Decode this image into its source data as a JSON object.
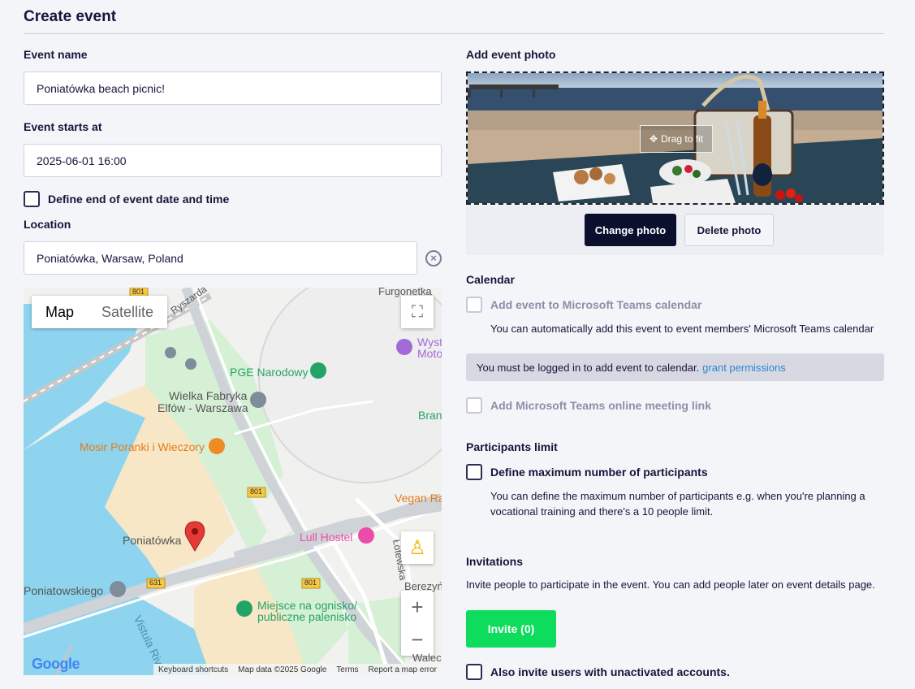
{
  "page": {
    "title": "Create event"
  },
  "left": {
    "event_name_label": "Event name",
    "event_name_value": "Poniatówka beach picnic!",
    "starts_label": "Event starts at",
    "starts_value": "2025-06-01 16:00",
    "define_end_label": "Define end of event date and time",
    "location_label": "Location",
    "location_value": "Poniatówka, Warsaw, Poland",
    "clear_icon": "close-circle-icon"
  },
  "map": {
    "type_map": "Map",
    "type_satellite": "Satellite",
    "labels": {
      "furgonetka": "Furgonetka",
      "ryszarda": "Ryszarda",
      "pge": "PGE Narodowy",
      "wyst": "Wyst",
      "moto": "Moto",
      "wielka1": "Wielka Fabryka",
      "wielka2": "Elfów - Warszawa",
      "bran": "Bran",
      "mosir": "Mosir Poranki i Wieczory",
      "vegan": "Vegan Ra",
      "poniatowka": "Poniatówka",
      "lull": "Lull Hostel",
      "lotewska": "Łotewska",
      "berezyn": "Berezyń",
      "poniatowskiego": "Poniatowskiego",
      "miejsce1": "Miejsce na ognisko/",
      "miejsce2": "publiczne palenisko",
      "vistula": "Vistula Riv",
      "walec": "Walec",
      "r801a": "801",
      "r801b": "801",
      "r801c": "801",
      "r631": "631"
    },
    "footer": {
      "keyboard": "Keyboard shortcuts",
      "data": "Map data ©2025 Google",
      "terms": "Terms",
      "report": "Report a map error"
    },
    "logo": "Google",
    "zoom_in": "+",
    "zoom_out": "−"
  },
  "right": {
    "photo_label": "Add event photo",
    "drag_label": "Drag to fit",
    "change_photo": "Change photo",
    "delete_photo": "Delete photo",
    "calendar_title": "Calendar",
    "add_teams_calendar": "Add event to Microsoft Teams calendar",
    "teams_calendar_note": "You can automatically add this event to event members' Microsoft Teams calendar",
    "alert_text": "You must be logged in to add event to calendar.",
    "alert_link": "grant permissions",
    "add_teams_link": "Add Microsoft Teams online meeting link",
    "participants_title": "Participants limit",
    "define_max": "Define maximum number of participants",
    "participants_note_1": "You can define the maximum number of participants e.g. when you're planning a",
    "participants_note_2": "vocational training and there's a 10 people limit.",
    "invitations_title": "Invitations",
    "invitations_note": "Invite people to participate in the event. You can add people later on event details page.",
    "invite_button": "Invite (0)",
    "unactivated_label": "Also invite users with unactivated accounts."
  },
  "colors": {
    "primary_dark": "#0a0f2e",
    "accent_green": "#0ddc5d",
    "link": "#2f86d6",
    "map_water": "#8fd4ee",
    "map_sand": "#f7e7c6",
    "map_park": "#d6f0d5"
  }
}
